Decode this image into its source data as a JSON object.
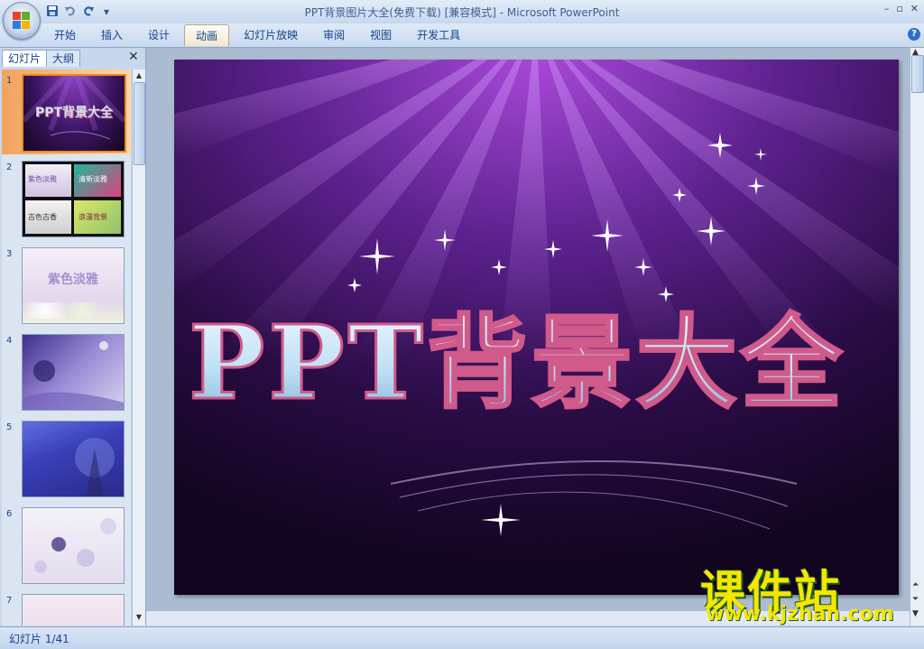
{
  "window": {
    "title": "PPT背景图片大全(免费下载) [兼容模式] - Microsoft PowerPoint",
    "controls": [
      "–",
      "▫",
      "✕"
    ]
  },
  "quick_access": {
    "save_icon": "save-icon",
    "undo_icon": "undo-icon",
    "redo_icon": "redo-icon",
    "customize_icon": "customize-qat-icon"
  },
  "ribbon": {
    "tabs": [
      {
        "label": "开始",
        "active": false
      },
      {
        "label": "插入",
        "active": false
      },
      {
        "label": "设计",
        "active": false
      },
      {
        "label": "动画",
        "active": true
      },
      {
        "label": "幻灯片放映",
        "active": false
      },
      {
        "label": "审阅",
        "active": false
      },
      {
        "label": "视图",
        "active": false
      },
      {
        "label": "开发工具",
        "active": false
      }
    ],
    "help": "?"
  },
  "panel": {
    "tabs": [
      "幻灯片",
      "大纲"
    ],
    "close": "✕",
    "slides": [
      {
        "num": "1",
        "thumb_text": "PPT背景大全",
        "selected": true
      },
      {
        "num": "2",
        "thumb_texts": [
          "紫色淡雅",
          "清新淡雅",
          "古色古香",
          "浪漫背景"
        ],
        "selected": false
      },
      {
        "num": "3",
        "thumb_text": "紫色淡雅",
        "selected": false
      },
      {
        "num": "4",
        "selected": false
      },
      {
        "num": "5",
        "selected": false
      },
      {
        "num": "6",
        "selected": false
      },
      {
        "num": "7",
        "selected": false
      }
    ]
  },
  "slide": {
    "title": "PPT背景大全"
  },
  "status": {
    "text": "幻灯片 1/41"
  },
  "watermark": {
    "cn": "课件站",
    "url": "www.kjzhan.com"
  },
  "colors": {
    "accent": "#15428b",
    "selected_thumb": "#f2a35d",
    "slide_purple": "#6a2f9a",
    "watermark": "#f5e600"
  }
}
